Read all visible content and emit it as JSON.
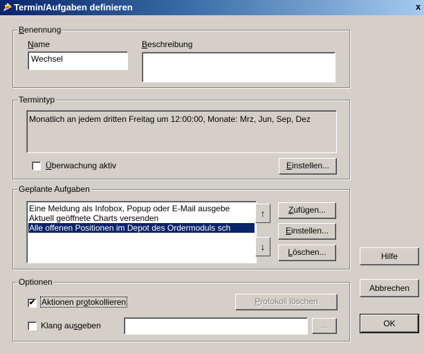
{
  "window": {
    "title": "Termin/Aufgaben definieren",
    "close_glyph": "x"
  },
  "benennung": {
    "legend_first": "B",
    "legend_rest": "enennung",
    "name_label_first": "N",
    "name_label_rest": "ame",
    "name_value": "Wechsel",
    "desc_label_first": "B",
    "desc_label_rest": "eschreibung",
    "desc_value": ""
  },
  "termintyp": {
    "legend": "Termintyp",
    "description": "Monatlich an jedem dritten Freitag um 12:00:00, Monate: Mrz, Jun, Sep, Dez",
    "monitor_label_first": "Ü",
    "monitor_label_rest": "berwachung aktiv",
    "monitor_checked": false,
    "settings_first": "E",
    "settings_rest": "instellen..."
  },
  "aufgaben": {
    "legend": "Geplante Aufgaben",
    "items": [
      {
        "text": "Eine Meldung als Infobox, Popup oder E-Mail ausgebe",
        "selected": false
      },
      {
        "text": "Aktuell geöffnete Charts versenden",
        "selected": false
      },
      {
        "text": "Alle offenen Positionen im Depot des Ordermoduls sch",
        "selected": true
      }
    ],
    "up_glyph": "↑",
    "down_glyph": "↓",
    "add_first": "Z",
    "add_rest": "ufügen...",
    "edit_first": "E",
    "edit_rest": "instellen...",
    "delete_first": "L",
    "delete_rest": "öschen..."
  },
  "optionen": {
    "legend": "Optionen",
    "log_label_pre": "Aktionen pr",
    "log_label_u": "o",
    "log_label_post": "tokollieren",
    "log_checked": true,
    "check_glyph": "✔",
    "clear_log_first": "P",
    "clear_log_rest": "rotokoll löschen",
    "sound_label_pre": "Klang au",
    "sound_label_u": "s",
    "sound_label_post": "geben",
    "sound_checked": false,
    "sound_value": "",
    "browse_label": "..."
  },
  "actions": {
    "help": "Hilfe",
    "cancel": "Abbrechen",
    "ok": "OK"
  },
  "colors": {
    "title_start": "#0a246a",
    "title_end": "#a6caf0",
    "dialog_bg": "#d4d0c8",
    "selection": "#0a246a"
  }
}
